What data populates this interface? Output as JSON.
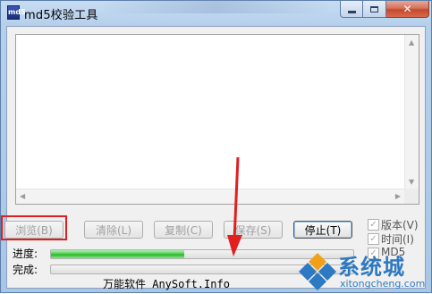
{
  "window": {
    "title": "md5校验工具",
    "app_icon_text": "md5"
  },
  "colors": {
    "accent_red": "#e02020",
    "progress_green": "#2cb52c",
    "watermark_blue": "#2d79c2"
  },
  "scroll": {
    "up": "▲",
    "down": "▼",
    "left": "◀",
    "right": "▶"
  },
  "buttons": {
    "browse": "浏览(B)",
    "clear": "清除(L)",
    "copy": "复制(C)",
    "save": "保存(S)",
    "stop": "停止(T)"
  },
  "options": {
    "version": {
      "label": "版本(V)",
      "checked": true
    },
    "time": {
      "label": "时间(I)",
      "checked": true
    },
    "md5": {
      "label": "MD5",
      "checked": true
    }
  },
  "progress": {
    "progress_label": "进度:",
    "progress_value": 0.44,
    "done_label": "完成:",
    "done_value": 0.0
  },
  "footer": {
    "text": "万能软件 AnySoft.Info"
  },
  "watermark": {
    "title": "系统城",
    "url": "xitongcheng.com"
  }
}
